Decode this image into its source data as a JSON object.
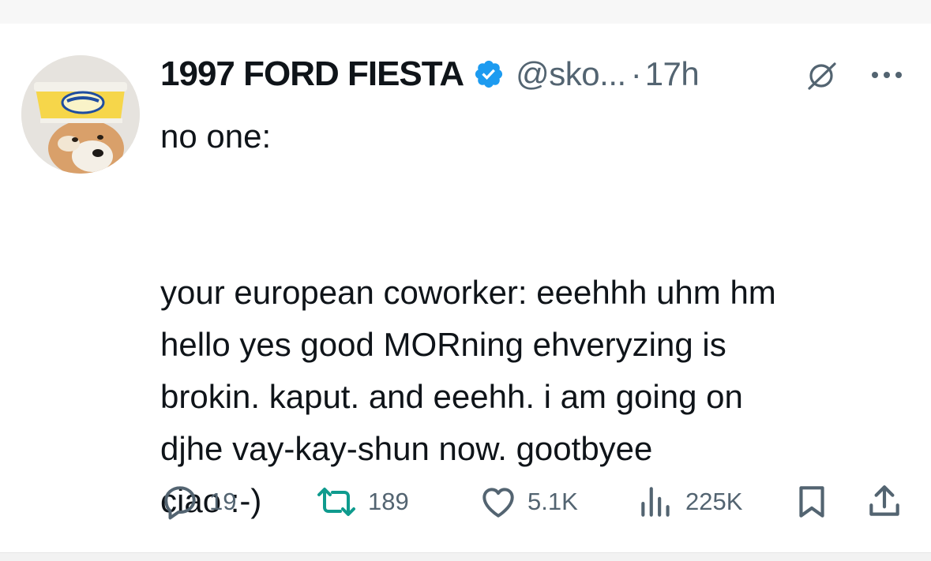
{
  "tweet": {
    "display_name": "1997 FORD FIESTA",
    "verified_icon": "verified-badge-icon",
    "handle": "@sko...",
    "separator": "·",
    "time": "17h",
    "avatar": "avatar",
    "grok_icon": "grok-icon",
    "more_icon": "more-icon",
    "text_lines_1": [
      "no one:"
    ],
    "text_lines_2": [
      "your european coworker: eeehhh uhm hm",
      "hello yes good MORning ehveryzing is",
      "brokin. kaput. and eeehh. i am going on",
      "djhe vay-kay-shun now. gootbyee",
      "ciao  :-)"
    ]
  },
  "actions": {
    "reply": {
      "icon": "reply-icon",
      "count": "19"
    },
    "retweet": {
      "icon": "retweet-icon",
      "count": "189"
    },
    "like": {
      "icon": "heart-icon",
      "count": "5.1K"
    },
    "views": {
      "icon": "views-icon",
      "count": "225K"
    },
    "bookmark": {
      "icon": "bookmark-icon"
    },
    "share": {
      "icon": "share-icon"
    }
  },
  "colors": {
    "text": "#0f1419",
    "secondary": "#536471",
    "verified": "#1d9bf0",
    "background": "#ffffff"
  }
}
